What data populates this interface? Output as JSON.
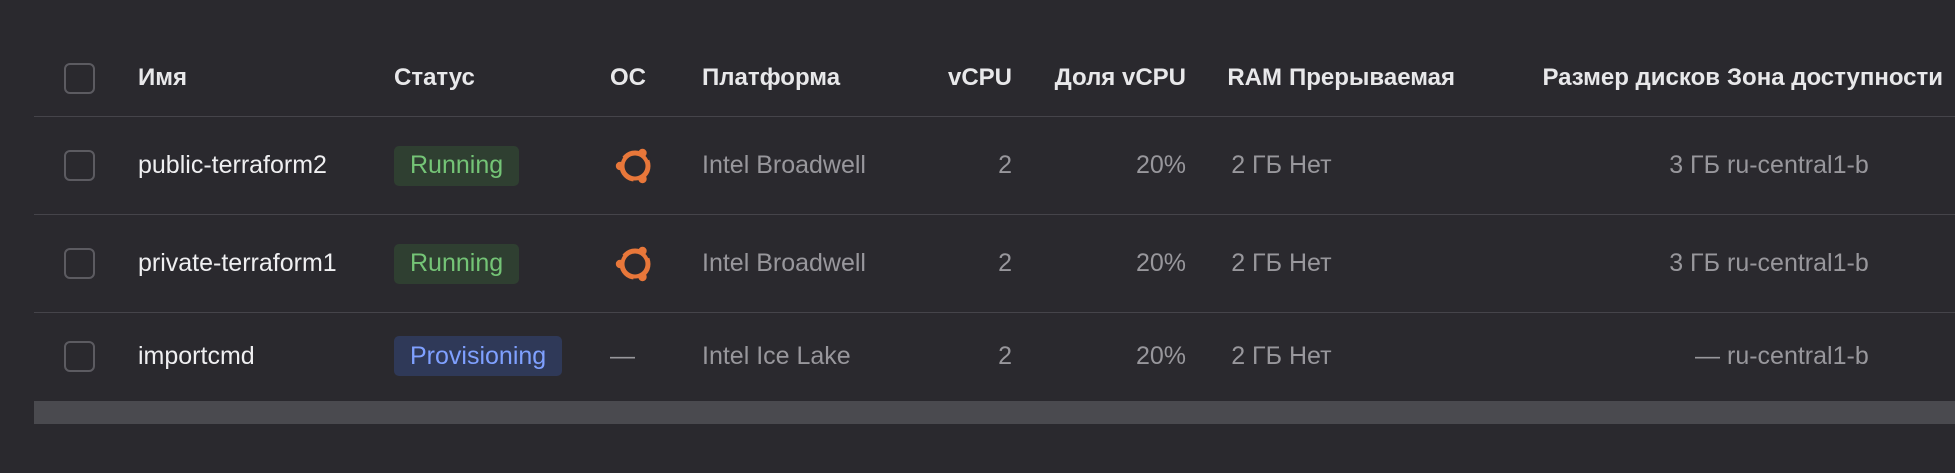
{
  "columns": {
    "name": "Имя",
    "status": "Статус",
    "os": "ОС",
    "platform": "Платформа",
    "vcpu": "vCPU",
    "vcpu_share": "Доля vCPU",
    "ram": "RAM",
    "preemptible": "Прерываемая",
    "disk_size": "Размер дисков",
    "zone": "Зона доступности"
  },
  "rows": [
    {
      "name": "public-terraform2",
      "status": "Running",
      "os_icon": "ubuntu-icon",
      "platform": "Intel Broadwell",
      "vcpu": "2",
      "vcpu_share": "20%",
      "ram": "2 ГБ",
      "preemptible": "Нет",
      "disk_size": "3 ГБ",
      "zone": "ru-central1-b"
    },
    {
      "name": "private-terraform1",
      "status": "Running",
      "os_icon": "ubuntu-icon",
      "platform": "Intel Broadwell",
      "vcpu": "2",
      "vcpu_share": "20%",
      "ram": "2 ГБ",
      "preemptible": "Нет",
      "disk_size": "3 ГБ",
      "zone": "ru-central1-b"
    },
    {
      "name": "importcmd",
      "status": "Provisioning",
      "os": "—",
      "platform": "Intel Ice Lake",
      "vcpu": "2",
      "vcpu_share": "20%",
      "ram": "2 ГБ",
      "preemptible": "Нет",
      "disk_size": "—",
      "zone": "ru-central1-b"
    }
  ],
  "colors": {
    "background": "#2a292e",
    "running_text": "#74c476",
    "running_bg": "#2f3f31",
    "provisioning_text": "#7fa0ff",
    "provisioning_bg": "#2f3958",
    "ubuntu_orange": "#e8773a"
  }
}
